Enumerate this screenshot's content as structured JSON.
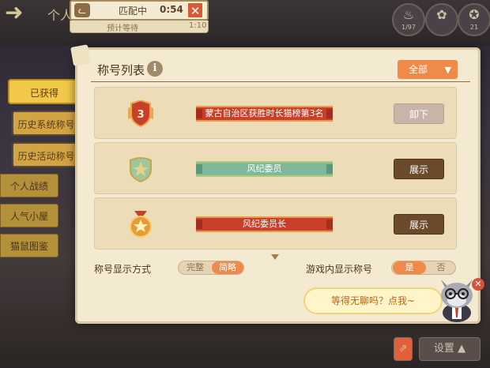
{
  "header": {
    "title_partial": "个人",
    "back_icon": "back-arrow-icon",
    "stats": [
      {
        "value": "1/97",
        "icon": "flame-icon"
      },
      {
        "value": "",
        "icon": "paw-icon"
      },
      {
        "value": "21",
        "icon": "medal-icon"
      }
    ]
  },
  "match": {
    "status": "匹配中",
    "timer": "0:54",
    "close_label": "✕",
    "estimate_label": "预计等待",
    "estimate_time": "1:10"
  },
  "background_tabs": [
    "个人战绩",
    "人气小屋",
    "猫鼠图鉴"
  ],
  "side_tabs": [
    {
      "label": "已获得",
      "active": true
    },
    {
      "label": "历史系统称号",
      "active": false
    },
    {
      "label": "历史活动称号",
      "active": false
    }
  ],
  "panel": {
    "title": "称号列表",
    "info_glyph": "i",
    "filter_label": "全部"
  },
  "titles": [
    {
      "badge": "shield-number-badge",
      "badge_text": "3",
      "name": "蒙古自治区获胜时长猫榜第3名",
      "banner_color": "red",
      "button": "卸下",
      "button_state": "unequip"
    },
    {
      "badge": "green-shield-star-badge",
      "badge_text": "",
      "name": "风纪委员",
      "banner_color": "green",
      "button": "展示",
      "button_state": "show"
    },
    {
      "badge": "gold-medal-star-badge",
      "badge_text": "",
      "name": "风纪委员长",
      "banner_color": "red",
      "button": "展示",
      "button_state": "show"
    }
  ],
  "options": {
    "display_mode_label": "称号显示方式",
    "display_mode_options": [
      "完整",
      "简略"
    ],
    "display_mode_selected": "简略",
    "ingame_label": "游戏内显示称号",
    "ingame_options": [
      "是",
      "否"
    ],
    "ingame_selected": "是"
  },
  "helper": {
    "bubble_text": "等得无聊吗？点我~",
    "close_label": "✕"
  },
  "bottom": {
    "settings_label": "设置"
  },
  "colors": {
    "accent_orange": "#f08a4b",
    "panel_bg": "#f4ead2",
    "tab_gold": "#f2c84a",
    "banner_red": "#c8402a",
    "banner_green": "#7fb89a",
    "button_brown": "#6a4a2a"
  }
}
